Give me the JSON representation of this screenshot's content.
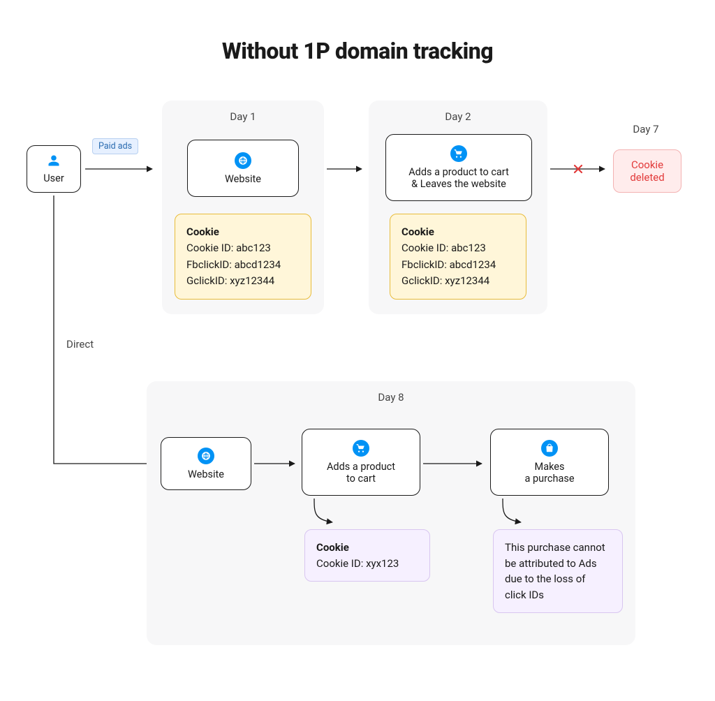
{
  "title": "Without 1P domain tracking",
  "badge_paid_ads": "Paid ads",
  "label_direct": "Direct",
  "user_label": "User",
  "day1": {
    "heading": "Day 1",
    "card_label": "Website",
    "cookie_header": "Cookie",
    "cookie_line1": "Cookie ID: abc123",
    "cookie_line2": "FbclickID: abcd1234",
    "cookie_line3": "GclickID: xyz12344"
  },
  "day2": {
    "heading": "Day 2",
    "card_line1": "Adds a product to cart",
    "card_line2": "& Leaves the website",
    "cookie_header": "Cookie",
    "cookie_line1": "Cookie ID: abc123",
    "cookie_line2": "FbclickID: abcd1234",
    "cookie_line3": "GclickID: xyz12344"
  },
  "day7": {
    "heading": "Day 7",
    "label_line1": "Cookie",
    "label_line2": "deleted"
  },
  "day8": {
    "heading": "Day 8",
    "website_label": "Website",
    "cart_line1": "Adds a product",
    "cart_line2": "to cart",
    "purchase_line1": "Makes",
    "purchase_line2": "a purchase",
    "cookie_header": "Cookie",
    "cookie_line1": "Cookie ID: xyx123",
    "note_line1": "This purchase cannot",
    "note_line2": "be attributed to Ads",
    "note_line3": "due to the loss of",
    "note_line4": "click IDs"
  },
  "colors": {
    "accent": "#0092f5",
    "danger": "#e23a3a"
  }
}
